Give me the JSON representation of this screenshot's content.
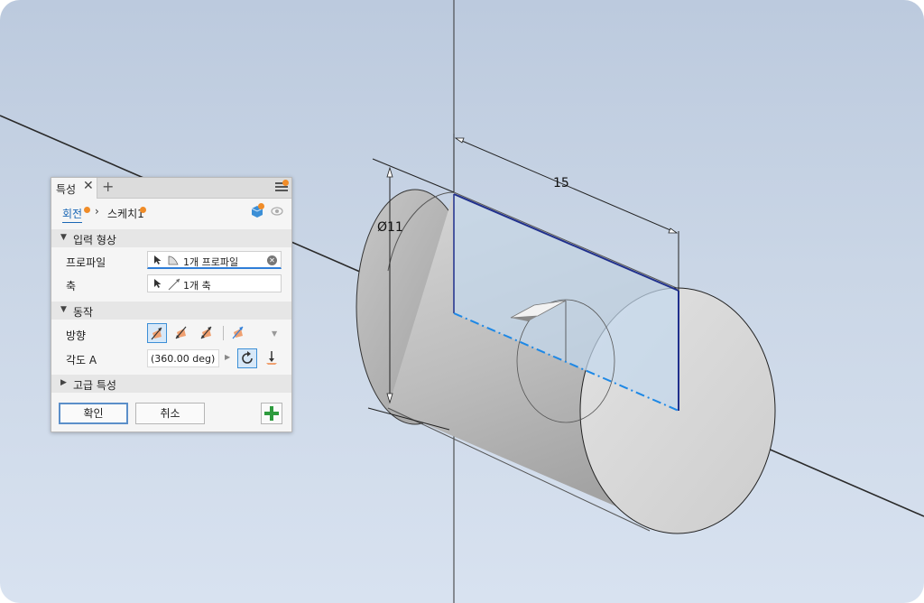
{
  "dimensions": {
    "diameter": "Ø11",
    "length": "15"
  },
  "panel": {
    "tab_label": "특성",
    "tab_close": "✕",
    "tab_add": "+",
    "breadcrumb": {
      "item1": "회전",
      "separator": "›",
      "item2": "스케치1"
    },
    "sections": {
      "input_geometry": "입력 형상",
      "behavior": "동작",
      "advanced": "고급 특성"
    },
    "fields": {
      "profile_label": "프로파일",
      "profile_value": "1개 프로파일",
      "axis_label": "축",
      "axis_value": "1개 축",
      "direction_label": "방향",
      "angle_label": "각도 A",
      "angle_value": "(360.00 deg)"
    },
    "buttons": {
      "ok": "확인",
      "cancel": "취소"
    }
  },
  "colors": {
    "accent": "#1a67b5",
    "notification": "#f08c28",
    "sketch_line": "#1f2f8c",
    "axis_line": "#1e88e5",
    "add_green": "#2e9b3e"
  },
  "icons": [
    "menu-icon",
    "cursor-icon",
    "profile-icon",
    "axis-icon",
    "direction-icon",
    "flip-icon",
    "add-icon",
    "eye-icon"
  ]
}
